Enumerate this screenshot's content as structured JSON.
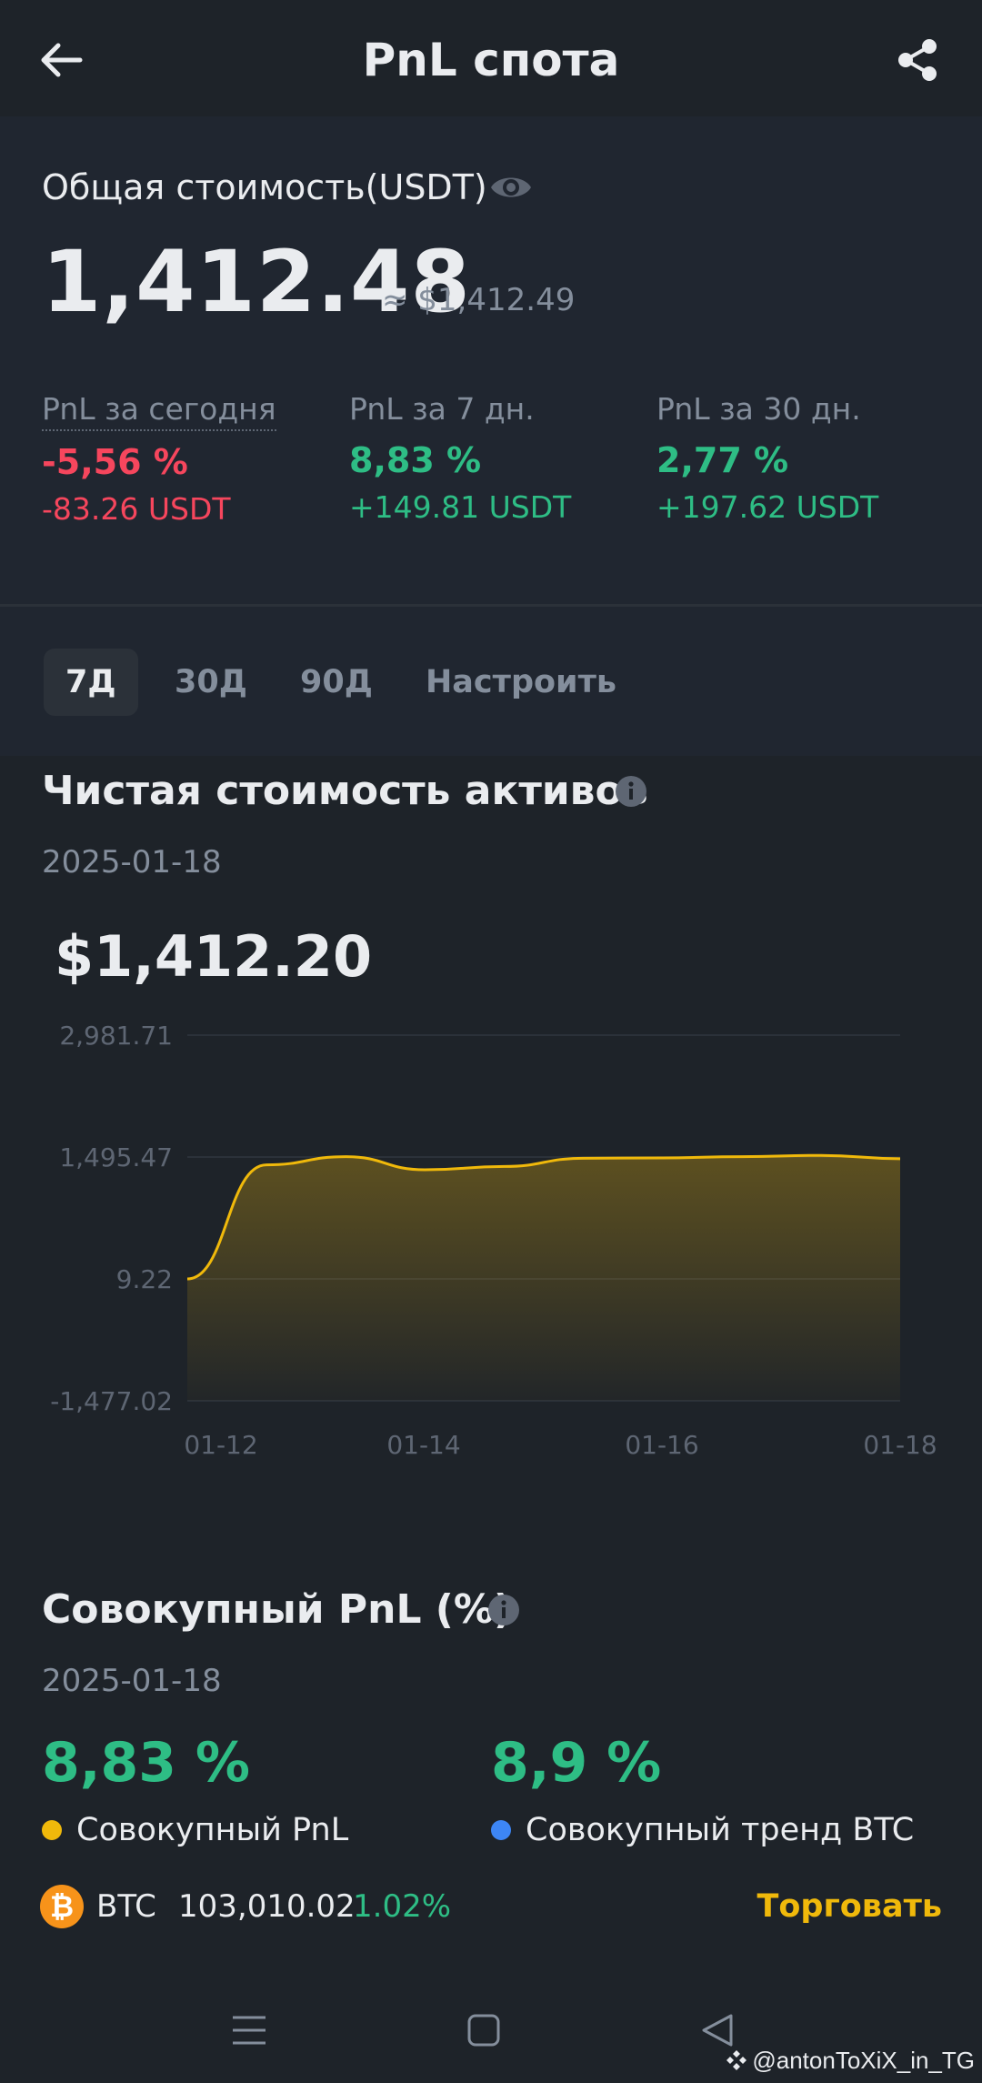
{
  "header": {
    "title": "PnL спота",
    "back_icon": "arrow-left-icon",
    "share_icon": "share-icon"
  },
  "summary": {
    "total_label": "Общая стоимость(USDT)",
    "total_value": "1,412.48",
    "total_approx": "≈ $1,412.49",
    "pnl": [
      {
        "label": "PnL за сегодня",
        "percent": "-5,56 %",
        "usdt": "-83.26 USDT",
        "trend": "down"
      },
      {
        "label": "PnL за 7 дн.",
        "percent": "8,83 %",
        "usdt": "+149.81 USDT",
        "trend": "up"
      },
      {
        "label": "PnL за 30 дн.",
        "percent": "2,77 %",
        "usdt": "+197.62 USDT",
        "trend": "up"
      }
    ]
  },
  "tabs": [
    {
      "label": "7Д",
      "active": true
    },
    {
      "label": "30Д",
      "active": false
    },
    {
      "label": "90Д",
      "active": false
    },
    {
      "label": "Настроить",
      "active": false
    }
  ],
  "net_assets": {
    "title": "Чистая стоимость активов",
    "date": "2025-01-18",
    "value": "$1,412.20"
  },
  "chart_data": {
    "type": "area",
    "x": [
      "01-12",
      "01-13",
      "01-13",
      "01-14",
      "01-14",
      "01-15",
      "01-16",
      "01-17",
      "01-17",
      "01-18"
    ],
    "values": [
      9.22,
      1400,
      1500,
      1340,
      1380,
      1480,
      1485,
      1500,
      1515,
      1475
    ],
    "x_tick_labels": [
      "01-12",
      "01-14",
      "01-16",
      "01-18"
    ],
    "y_tick_labels": [
      "2,981.71",
      "1,495.47",
      "9.22",
      "-1,477.02"
    ],
    "ylim": [
      -1477.02,
      2981.71
    ],
    "line_color": "#F0B90B",
    "grid": true
  },
  "cumulative": {
    "title": "Совокупный PnL (%)",
    "date": "2025-01-18",
    "pnl_value": "8,83 %",
    "btc_value": "8,9 %",
    "pnl_label": "Совокупный PnL",
    "btc_label": "Совокупный тренд BTC",
    "pnl_dot_color": "#F0B90B",
    "btc_dot_color": "#3D86F5"
  },
  "ticker": {
    "logo_glyph": "₿",
    "symbol": "BTC",
    "price": "103,010.02",
    "change": "1.02%",
    "trade_label": "Торговать"
  },
  "navbar": {
    "menu_icon": "menu-icon",
    "home_icon": "home-square-icon",
    "back_icon": "triangle-back-icon"
  },
  "watermark": "@antonToXiX_in_TG"
}
